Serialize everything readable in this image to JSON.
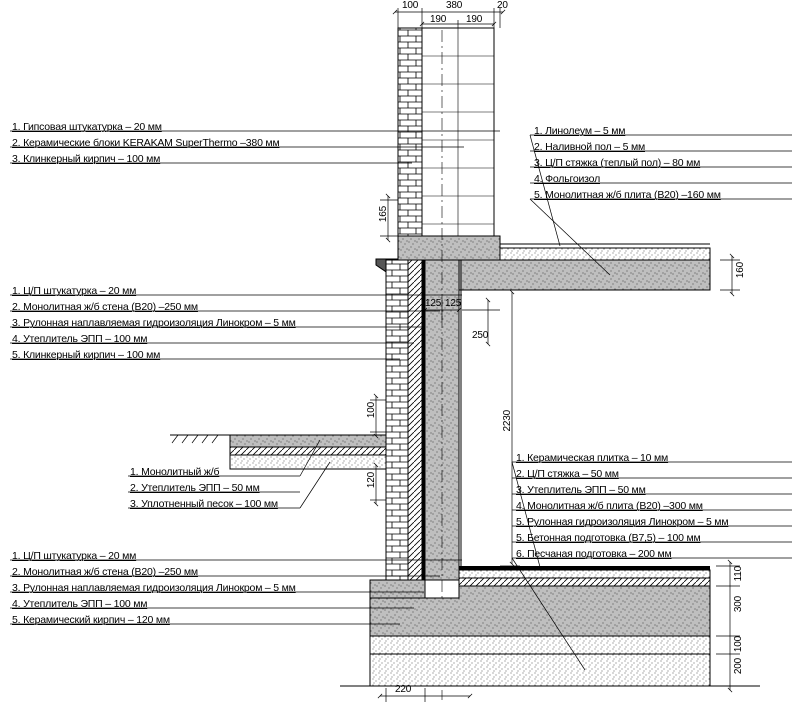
{
  "dims": {
    "top_left_100": "100",
    "top_mid_380": "380",
    "top_20": "20",
    "top_190_a": "190",
    "top_190_b": "190",
    "r_160": "160",
    "v_165": "165",
    "v_125a": "125",
    "v_125b": "125",
    "v_250": "250",
    "r_2230": "2230",
    "l_100": "100",
    "l_120": "120",
    "r_110": "110",
    "r_300": "300",
    "r_100b": "100",
    "r_200": "200",
    "bot_220": "220"
  },
  "groupA": {
    "l1": "1.   Гипсовая штукатурка – 20 мм",
    "l2": "2.   Керамические блоки KERAKAM SuperThermo –380 мм",
    "l3": "3.   Клинкерный кирпич – 100 мм"
  },
  "groupB": {
    "l1": "1. Линолеум – 5 мм",
    "l2": "2. Наливной пол – 5 мм",
    "l3": "3. Ц/П стяжка (теплый пол) – 80 мм",
    "l4": "4. Фольгоизол",
    "l5": "5. Монолитная ж/б плита  (В20) –160 мм"
  },
  "groupC": {
    "l1": "1.   Ц/П штукатурка – 20 мм",
    "l2": "2.   Монолитная ж/б стена (В20) –250 мм",
    "l3": "3.   Рулонная наплавляемая гидроизоляция Линокром – 5 мм",
    "l4": "4.   Утеплитель ЭПП – 100 мм",
    "l5": "5.   Клинкерный кирпич – 100 мм"
  },
  "groupD": {
    "l1": "1. Монолитный ж/б",
    "l2": "2. Утеплитель ЭПП – 50 мм",
    "l3": "3. Уплотненный песок – 100 мм"
  },
  "groupE": {
    "l1": "1. Керамическая плитка – 10 мм",
    "l2": "2. Ц/П стяжка – 50 мм",
    "l3": "3. Утеплитель ЭПП – 50 мм",
    "l4": "4. Монолитная ж/б плита  (В20) –300 мм",
    "l5": "5. Рулонная гидроизоляция Линокром – 5 мм",
    "l6": "5. Бетонная подготовка (В7,5) – 100 мм",
    "l7": "6. Песчаная подготовка – 200 мм"
  },
  "groupF": {
    "l1": "1.   Ц/П штукатурка – 20 мм",
    "l2": "2.   Монолитная ж/б стена (В20) –250 мм",
    "l3": "3.   Рулонная наплавляемая гидроизоляция Линокром – 5 мм",
    "l4": "4.   Утеплитель ЭПП – 100 мм",
    "l5": "5.   Керамический кирпич – 120 мм"
  }
}
